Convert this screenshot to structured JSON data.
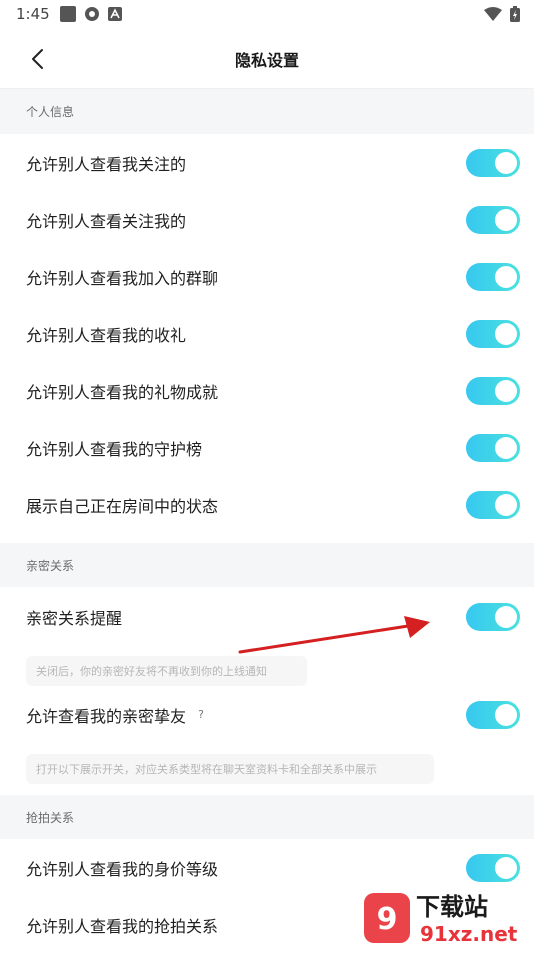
{
  "status_bar": {
    "time": "1:45"
  },
  "header": {
    "title": "隐私设置"
  },
  "sections": [
    {
      "title": "个人信息",
      "items": [
        {
          "label": "允许别人查看我关注的",
          "on": true
        },
        {
          "label": "允许别人查看关注我的",
          "on": true
        },
        {
          "label": "允许别人查看我加入的群聊",
          "on": true
        },
        {
          "label": "允许别人查看我的收礼",
          "on": true
        },
        {
          "label": "允许别人查看我的礼物成就",
          "on": true
        },
        {
          "label": "允许别人查看我的守护榜",
          "on": true
        },
        {
          "label": "展示自己正在房间中的状态",
          "on": true
        }
      ]
    },
    {
      "title": "亲密关系",
      "items": [
        {
          "label": "亲密关系提醒",
          "on": true,
          "hint": "关闭后，你的亲密好友将不再收到你的上线通知"
        },
        {
          "label": "允许查看我的亲密挚友",
          "help": "?",
          "on": true,
          "hint": "打开以下展示开关，对应关系类型将在聊天室资料卡和全部关系中展示"
        }
      ]
    },
    {
      "title": "抢拍关系",
      "items": [
        {
          "label": "允许别人查看我的身价等级",
          "on": true
        },
        {
          "label": "允许别人查看我的抢拍关系",
          "on": true
        }
      ]
    }
  ],
  "watermark": {
    "text": "下载站",
    "url_text": "91xz.net"
  },
  "colors": {
    "toggle_start": "#37c8f0",
    "toggle_end": "#4be1df",
    "arrow": "#d42020",
    "section_bg": "#f5f6f8"
  }
}
